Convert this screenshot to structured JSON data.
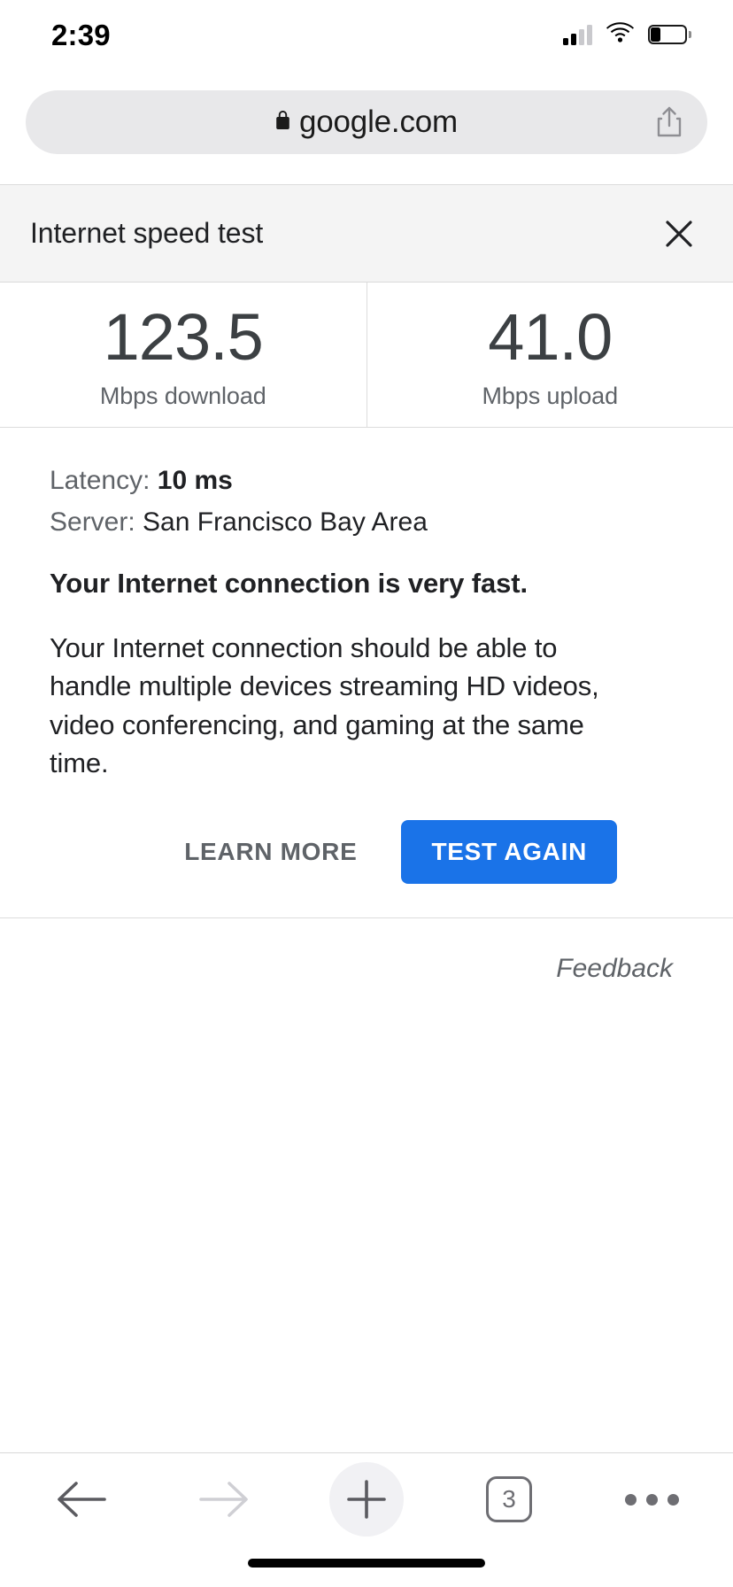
{
  "status_bar": {
    "time": "2:39",
    "cellular_icon": "cellular-signal-icon",
    "wifi_icon": "wifi-icon",
    "battery_icon": "battery-icon",
    "signal_bars_filled": 2,
    "signal_bars_total": 4,
    "battery_percent": 30
  },
  "browser": {
    "url": "google.com",
    "lock_icon": "lock-icon",
    "share_icon": "share-icon",
    "url_bar_bg": "#e8e8ea"
  },
  "speed_test": {
    "title": "Internet speed test",
    "close_icon": "close-icon",
    "download": {
      "value": "123.5",
      "label": "Mbps download"
    },
    "upload": {
      "value": "41.0",
      "label": "Mbps upload"
    },
    "latency": {
      "label": "Latency:",
      "value": "10 ms"
    },
    "server": {
      "label": "Server:",
      "value": "San Francisco Bay Area"
    },
    "headline": "Your Internet connection is very fast.",
    "body": "Your Internet connection should be able to handle multiple devices streaming HD videos, video conferencing, and gaming at the same time.",
    "learn_more_label": "LEARN MORE",
    "test_again_label": "TEST AGAIN",
    "feedback_label": "Feedback",
    "accent_color": "#1a73e8",
    "header_bg": "#f4f4f4"
  },
  "toolbar": {
    "back_icon": "back-arrow-icon",
    "forward_icon": "forward-arrow-icon",
    "new_tab_icon": "plus-icon",
    "tabs_icon": "tabs-icon",
    "tab_count": "3",
    "more_icon": "more-options-icon",
    "back_enabled": true,
    "forward_enabled": false
  }
}
